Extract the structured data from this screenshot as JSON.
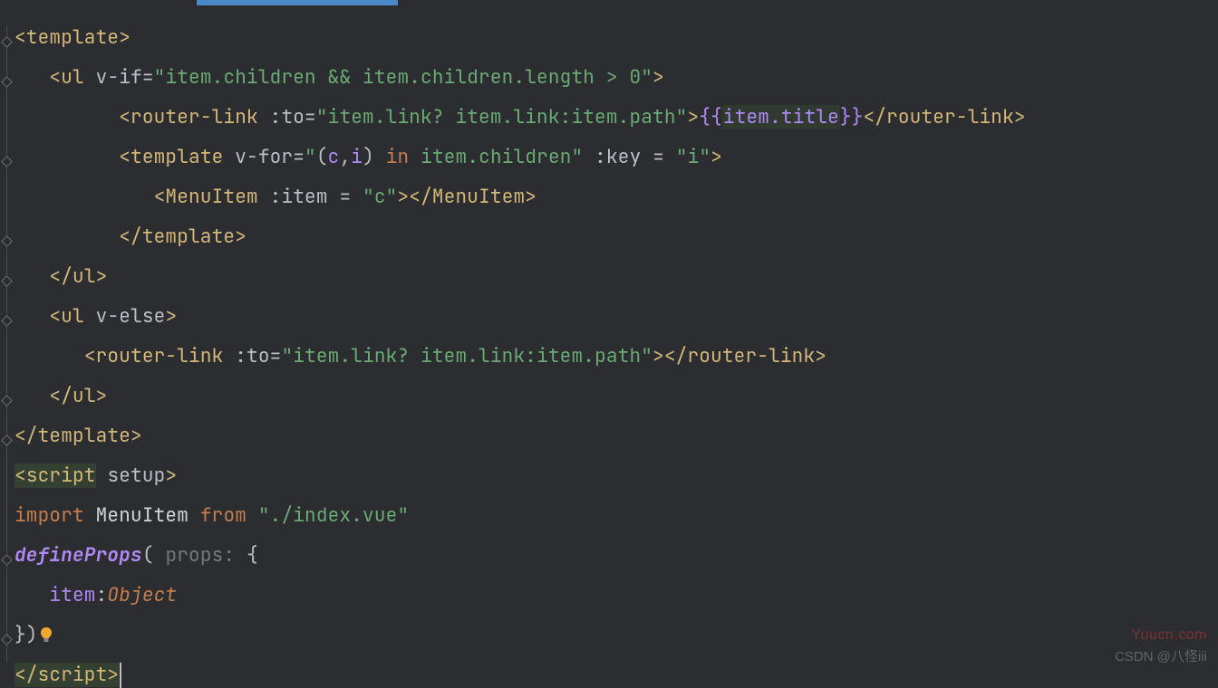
{
  "code": {
    "lines": [
      {
        "indent": 0,
        "tokens": [
          [
            "c-bracket",
            "<"
          ],
          [
            "c-tag",
            "template"
          ],
          [
            "c-bracket",
            ">"
          ]
        ]
      },
      {
        "indent": 1,
        "tokens": [
          [
            "c-bracket",
            "<"
          ],
          [
            "c-tag",
            "ul"
          ],
          [
            "",
            ""
          ],
          [
            "",
            " "
          ],
          [
            "c-attr",
            "v-if"
          ],
          [
            "c-punc",
            "="
          ],
          [
            "c-string",
            "\"item.children && item.children.length > 0\""
          ],
          [
            "c-bracket",
            ">"
          ]
        ]
      },
      {
        "indent": 3,
        "tokens": [
          [
            "c-bracket",
            "<"
          ],
          [
            "c-tag",
            "router-link"
          ],
          [
            "",
            " "
          ],
          [
            "c-attr",
            ":to"
          ],
          [
            "c-punc",
            "="
          ],
          [
            "c-string",
            "\"item.link? item.link:item.path\""
          ],
          [
            "c-bracket",
            ">"
          ],
          [
            "c-purple",
            "{{"
          ],
          [
            "boxed-interp c-purple",
            "item.title"
          ],
          [
            "c-purple",
            "}}"
          ],
          [
            "c-bracket",
            "</"
          ],
          [
            "c-tag",
            "router-link"
          ],
          [
            "c-bracket",
            ">"
          ]
        ]
      },
      {
        "indent": 3,
        "tokens": [
          [
            "c-bracket",
            "<"
          ],
          [
            "c-tag",
            "template"
          ],
          [
            "",
            " "
          ],
          [
            "c-attr",
            "v-for"
          ],
          [
            "c-punc",
            "="
          ],
          [
            "c-string",
            "\""
          ],
          [
            "c-punc",
            "("
          ],
          [
            "c-purple",
            "c"
          ],
          [
            "c-punc",
            ","
          ],
          [
            "c-purple",
            "i"
          ],
          [
            "c-punc",
            ")"
          ],
          [
            "",
            " "
          ],
          [
            "c-orange",
            "in"
          ],
          [
            "",
            " "
          ],
          [
            "c-string",
            "item.children\""
          ],
          [
            "",
            " "
          ],
          [
            "c-attr",
            ":key"
          ],
          [
            "",
            " "
          ],
          [
            "c-punc",
            "="
          ],
          [
            "",
            " "
          ],
          [
            "c-string",
            "\"i\""
          ],
          [
            "c-bracket",
            ">"
          ]
        ]
      },
      {
        "indent": 4,
        "tokens": [
          [
            "c-bracket",
            "<"
          ],
          [
            "c-tag",
            "MenuItem"
          ],
          [
            "",
            " "
          ],
          [
            "c-attr",
            ":item"
          ],
          [
            "",
            " "
          ],
          [
            "c-punc",
            "="
          ],
          [
            "",
            " "
          ],
          [
            "c-string",
            "\"c\""
          ],
          [
            "c-bracket",
            "></"
          ],
          [
            "c-tag",
            "MenuItem"
          ],
          [
            "c-bracket",
            ">"
          ]
        ]
      },
      {
        "indent": 3,
        "tokens": [
          [
            "c-bracket",
            "</"
          ],
          [
            "c-tag",
            "template"
          ],
          [
            "c-bracket",
            ">"
          ]
        ]
      },
      {
        "indent": 1,
        "tokens": [
          [
            "c-bracket",
            "</"
          ],
          [
            "c-tag",
            "ul"
          ],
          [
            "c-bracket",
            ">"
          ]
        ]
      },
      {
        "indent": 1,
        "tokens": [
          [
            "c-bracket",
            "<"
          ],
          [
            "c-tag",
            "ul"
          ],
          [
            "",
            " "
          ],
          [
            "c-attr",
            "v-else"
          ],
          [
            "c-bracket",
            ">"
          ]
        ]
      },
      {
        "indent": 2,
        "tokens": [
          [
            "c-bracket",
            "<"
          ],
          [
            "c-tag",
            "router-link"
          ],
          [
            "",
            " "
          ],
          [
            "c-attr",
            ":to"
          ],
          [
            "c-punc",
            "="
          ],
          [
            "c-string",
            "\"item.link? item.link:item.path\""
          ],
          [
            "c-bracket",
            "></"
          ],
          [
            "c-tag",
            "router-link"
          ],
          [
            "c-bracket",
            ">"
          ]
        ]
      },
      {
        "indent": 1,
        "tokens": [
          [
            "c-bracket",
            "</"
          ],
          [
            "c-tag",
            "ul"
          ],
          [
            "c-bracket",
            ">"
          ]
        ]
      },
      {
        "indent": 0,
        "tokens": [
          [
            "c-bracket",
            "</"
          ],
          [
            "c-tag",
            "template"
          ],
          [
            "c-bracket",
            ">"
          ]
        ]
      },
      {
        "indent": 0,
        "tokens": [
          [
            "hl-script c-bracket",
            "<"
          ],
          [
            "hl-script c-tag",
            "script"
          ],
          [
            "",
            " "
          ],
          [
            "c-attr",
            "setup"
          ],
          [
            "c-bracket",
            ">"
          ]
        ]
      },
      {
        "indent": 0,
        "tokens": [
          [
            "c-orange",
            "import"
          ],
          [
            "",
            " "
          ],
          [
            "c-white",
            "MenuItem"
          ],
          [
            "",
            " "
          ],
          [
            "c-orange",
            "from"
          ],
          [
            "",
            " "
          ],
          [
            "c-string",
            "\"./index.vue\""
          ]
        ]
      },
      {
        "indent": 0,
        "tokens": [
          [
            "c-func",
            "defineProps"
          ],
          [
            "c-punc",
            "("
          ],
          [
            "",
            " "
          ],
          [
            "c-hint",
            "props:"
          ],
          [
            "",
            " "
          ],
          [
            "c-punc",
            "{"
          ]
        ]
      },
      {
        "indent": 1,
        "tokens": [
          [
            "c-purple",
            "item"
          ],
          [
            "c-punc",
            ":"
          ],
          [
            "c-type",
            "Object"
          ]
        ]
      },
      {
        "indent": 0,
        "tokens": [
          [
            "c-punc",
            "})"
          ],
          [
            "BULB",
            ""
          ]
        ]
      },
      {
        "indent": 0,
        "tokens": [
          [
            "hl-script c-bracket",
            "</"
          ],
          [
            "hl-script c-tag",
            "script"
          ],
          [
            "hl-script c-bracket",
            ">"
          ],
          [
            "CURSOR",
            ""
          ]
        ]
      }
    ]
  },
  "watermarks": {
    "top": "Yuucn.com",
    "bottom": "CSDN @八怪iii"
  }
}
